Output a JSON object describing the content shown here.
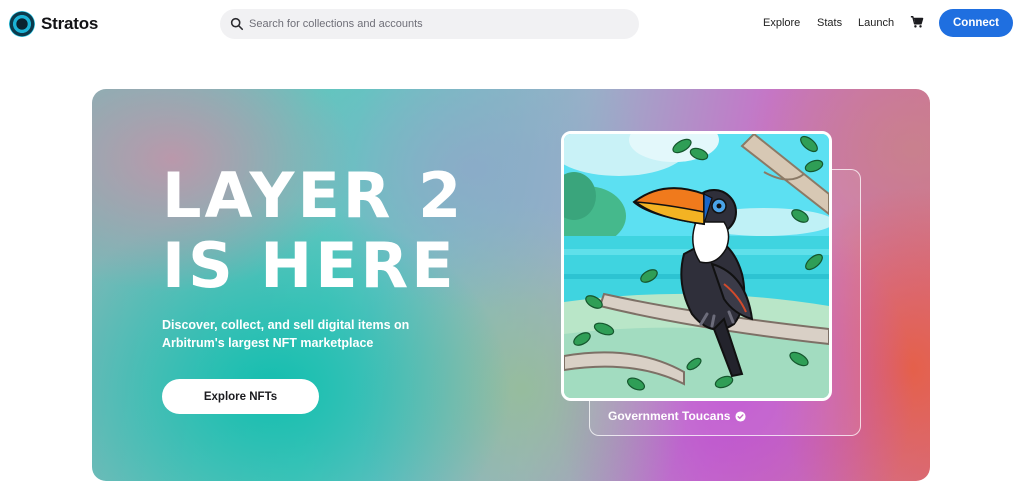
{
  "brand": {
    "name": "Stratos",
    "logo_icon": "stratos-logo-icon",
    "accent": "#1f6fe0"
  },
  "search": {
    "placeholder": "Search for collections and accounts",
    "value": ""
  },
  "nav": {
    "links": [
      "Explore",
      "Stats",
      "Launch"
    ],
    "cart_icon": "cart-icon",
    "connect_label": "Connect"
  },
  "hero": {
    "title_line1": "LAYER 2",
    "title_line2": "IS HERE",
    "subtitle": "Discover, collect, and sell digital items on Arbitrum's largest NFT marketplace",
    "cta_label": "Explore NFTs"
  },
  "featured": {
    "collection_name": "Government Toucans",
    "verified_icon": "verified-check-icon"
  }
}
